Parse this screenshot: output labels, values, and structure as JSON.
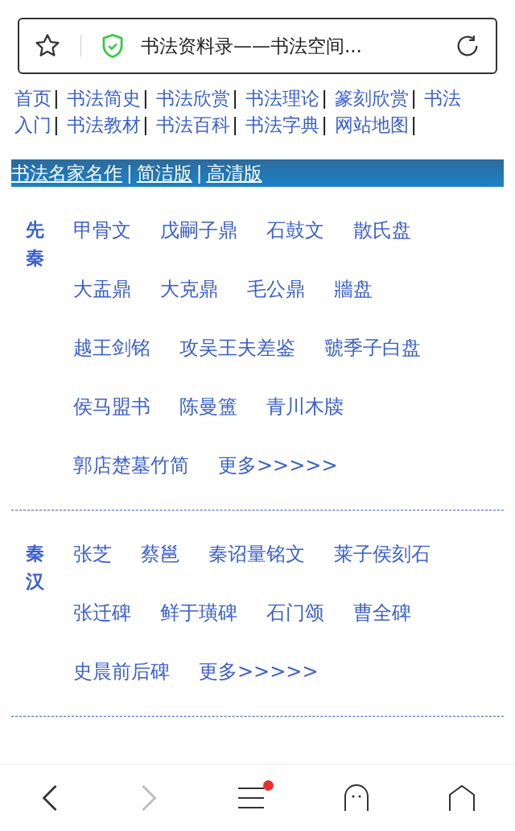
{
  "address_bar": {
    "title": "书法资料录——书法空间..."
  },
  "nav": [
    {
      "label": "首页",
      "sep": "|"
    },
    {
      "label": "书法简史",
      "sep": "|"
    },
    {
      "label": "书法欣赏",
      "sep": "|"
    },
    {
      "label": "书法理论",
      "sep": "|"
    },
    {
      "label": "篆刻欣赏",
      "sep": "|"
    },
    {
      "label": "书法"
    },
    {
      "label": "入门",
      "sep": "|"
    },
    {
      "label": "书法教材",
      "sep": "|"
    },
    {
      "label": "书法百科",
      "sep": "|"
    },
    {
      "label": "书法字典",
      "sep": "|"
    },
    {
      "label": "网站地图",
      "sep": "|"
    }
  ],
  "banner": [
    {
      "label": "书法名家名作",
      "sep": "|"
    },
    {
      "label": "简洁版",
      "sep": "|"
    },
    {
      "label": "高清版"
    }
  ],
  "sections": [
    {
      "title": "先秦",
      "items": [
        "甲骨文",
        "戊嗣子鼎",
        "石鼓文",
        "散氏盘",
        "大盂鼎",
        "大克鼎",
        "毛公鼎",
        "牆盘",
        "越王剑铭",
        "攻吴王夫差鉴",
        "虢季子白盘",
        "侯马盟书",
        "陈曼簠",
        "青川木牍",
        "郭店楚墓竹简",
        "更多>>>>>"
      ]
    },
    {
      "title": "秦汉",
      "items": [
        "张芝",
        "蔡邕",
        "秦诏量铭文",
        "莱子侯刻石",
        "张迁碑",
        "鲜于璜碑",
        "石门颂",
        "曹全碑",
        "史晨前后碑",
        "更多>>>>>"
      ]
    }
  ],
  "toolbar": {
    "back_disabled": false,
    "forward_disabled": true,
    "menu_badge": true
  }
}
